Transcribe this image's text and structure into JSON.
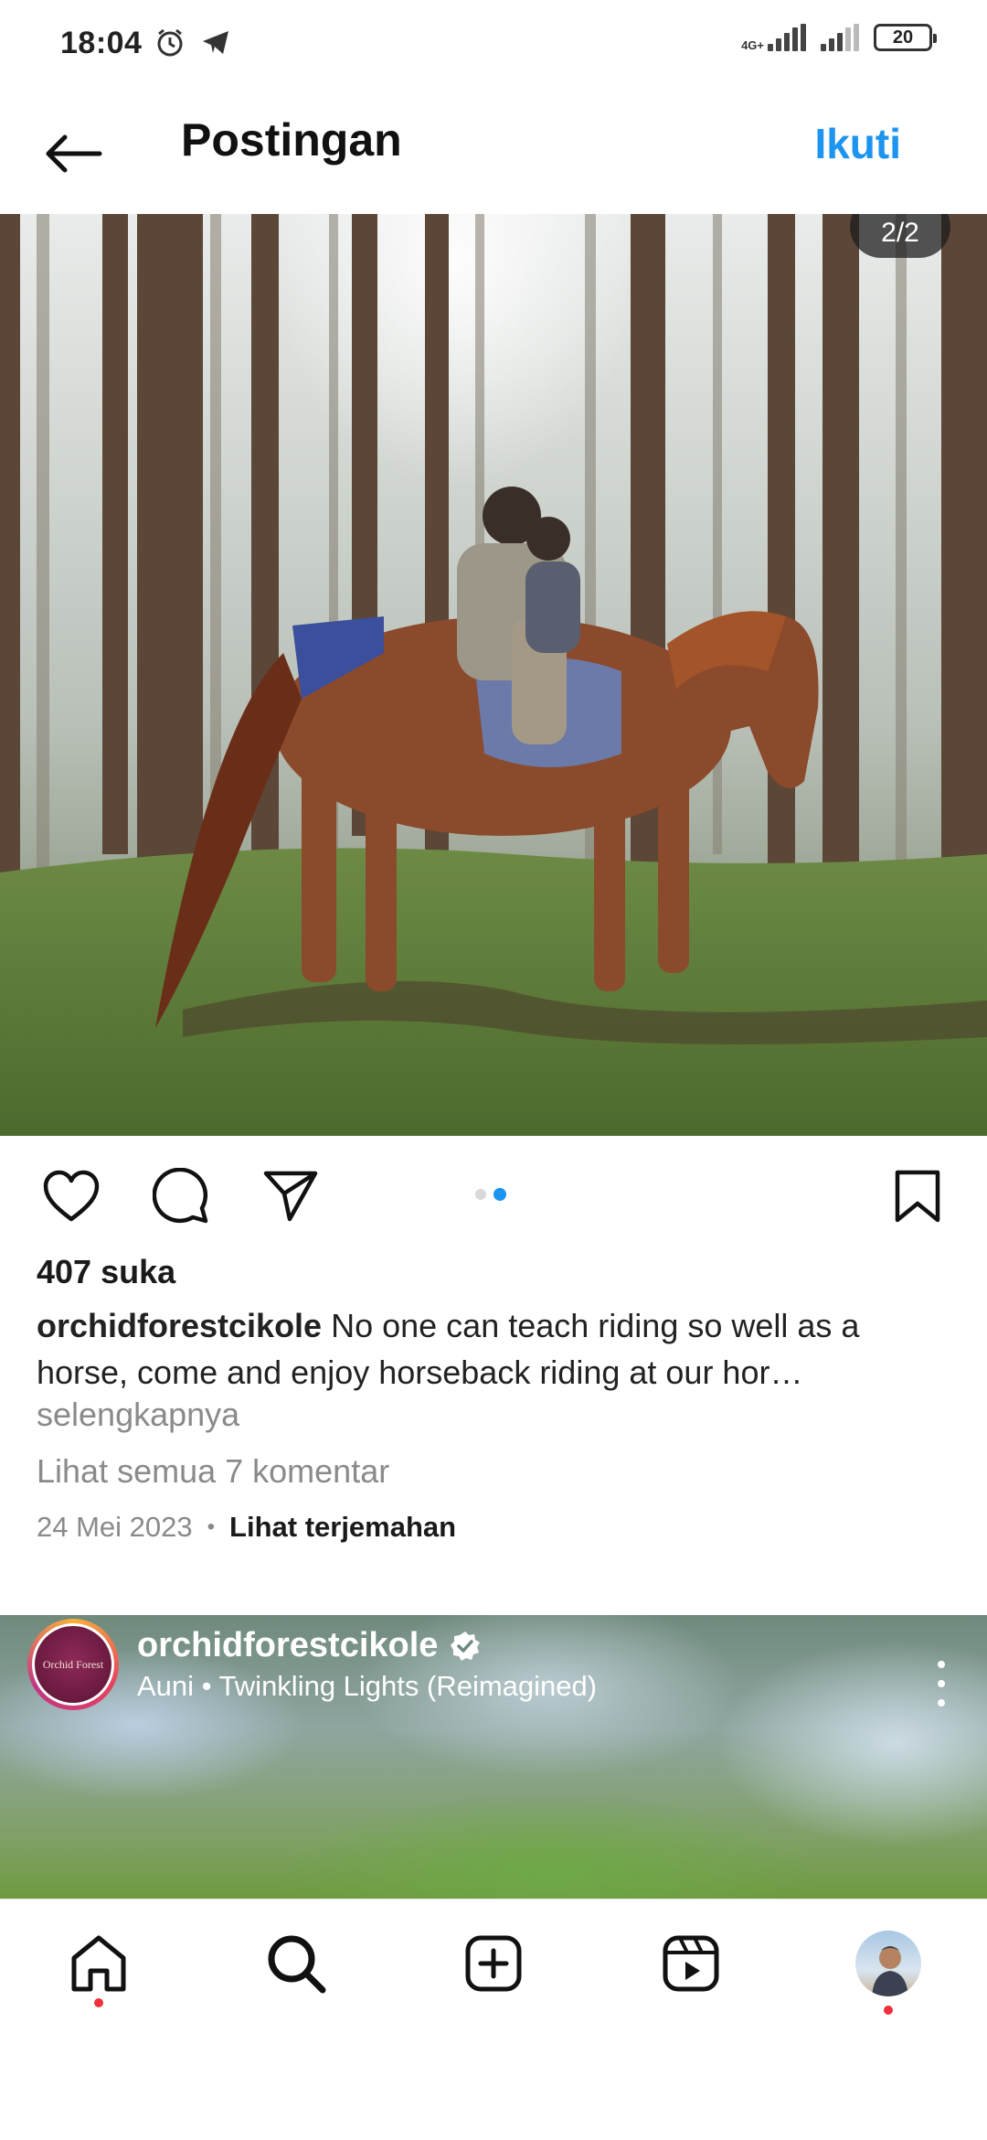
{
  "status_bar": {
    "time": "18:04",
    "network_label": "4G+",
    "battery": "20",
    "icons": [
      "alarm-icon",
      "telegram-icon",
      "signal-icon",
      "signal-icon",
      "battery-icon"
    ]
  },
  "header": {
    "title": "Postingan",
    "follow_label": "Ikuti",
    "back_icon": "arrow-left-icon"
  },
  "photo": {
    "page_counter": "2/2"
  },
  "actions": {
    "icons": [
      "heart-icon",
      "comment-icon",
      "share-icon",
      "bookmark-icon"
    ],
    "carousel_total": 2,
    "carousel_active": 2,
    "accent_color": "#1d95f0"
  },
  "post": {
    "likes": "407 suka",
    "username": "orchidforestcikole",
    "caption": " No one can teach riding so well as a horse, come and enjoy horseback riding at our hor…",
    "more": "selengkapnya",
    "comments_link": "Lihat semua 7 komentar",
    "date": "24 Mei 2023",
    "separator": "•",
    "translate": "Lihat terjemahan"
  },
  "next_post": {
    "username": "orchidforestcikole",
    "audio": "Auni • Twinkling Lights (Reimagined)",
    "avatar_text": "Orchid Forest"
  },
  "bottom_nav": {
    "items": [
      "home-icon",
      "search-icon",
      "create-icon",
      "reels-icon",
      "profile-avatar"
    ],
    "notification_color": "#f0303a"
  }
}
